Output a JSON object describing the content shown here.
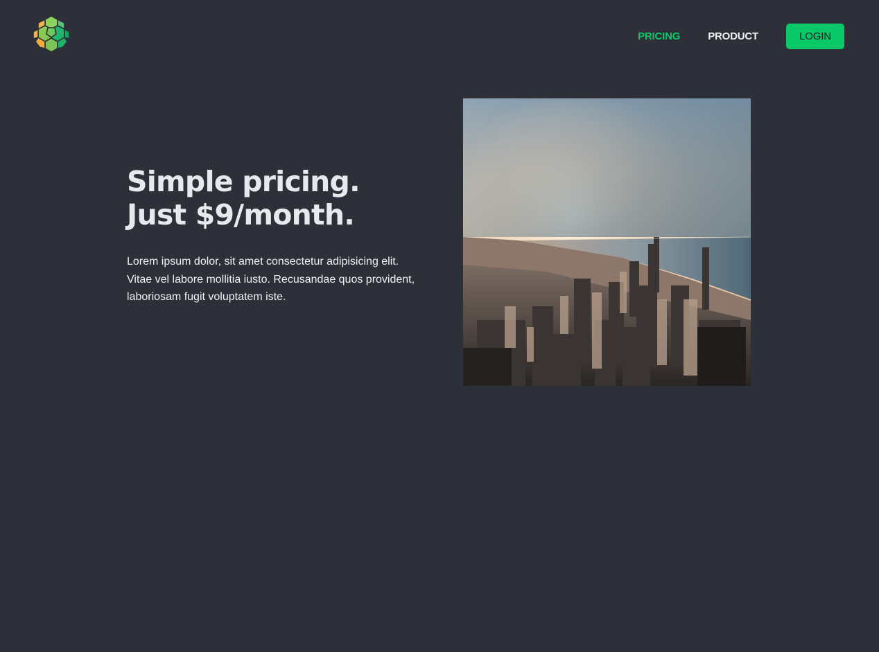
{
  "header": {
    "logo_icon": "globe-hex-logo-icon",
    "nav": [
      {
        "label": "PRICING",
        "active": true
      },
      {
        "label": "PRODUCT",
        "active": false
      }
    ],
    "login_label": "LOGIN"
  },
  "hero": {
    "title_line1": "Simple pricing.",
    "title_line2": "Just $9/month.",
    "description": "Lorem ipsum dolor, sit amet consectetur adipisicing elit. Vitae vel labore mollitia iusto. Recusandae quos provident, laboriosam fugit voluptatem iste.",
    "image_icon": "city-skyline-photo"
  },
  "colors": {
    "background": "#2d3038",
    "accent": "#08c868",
    "active_link": "#0fc569",
    "text": "#f0f1f3"
  }
}
